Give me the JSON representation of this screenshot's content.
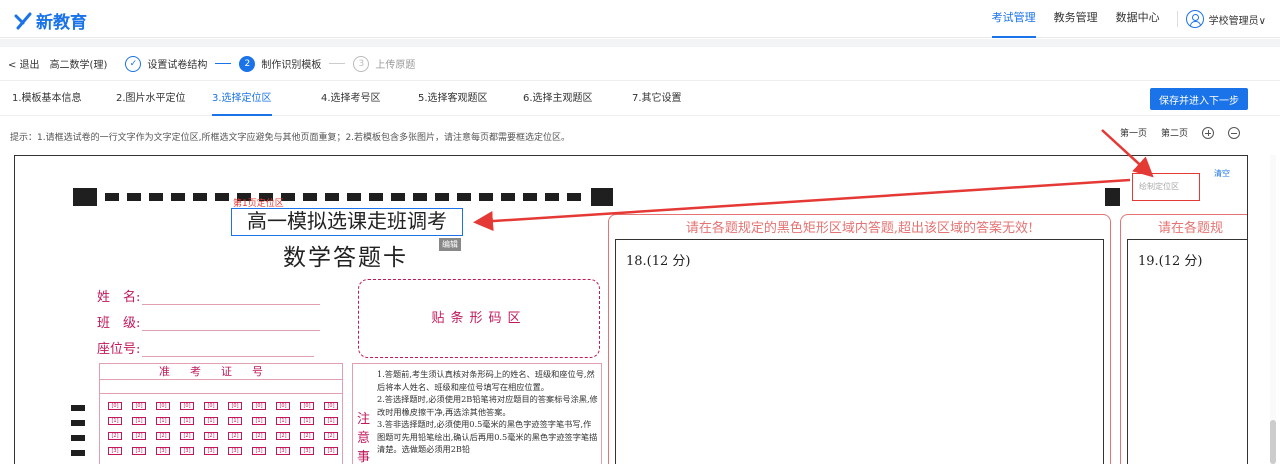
{
  "app": {
    "logo_text": "新教育"
  },
  "topnav": {
    "items": [
      "考试管理",
      "教务管理",
      "数据中心"
    ],
    "active_index": 0,
    "user_label": "学校管理员∨"
  },
  "stepbar": {
    "back_label": "< 退出",
    "subject": "高二数学(理)",
    "steps": [
      {
        "label": "设置试卷结构",
        "state": "done",
        "mark": "✓"
      },
      {
        "label": "制作识别模板",
        "state": "active",
        "mark": "2"
      },
      {
        "label": "上传原题",
        "state": "pending",
        "mark": "3"
      }
    ]
  },
  "tabs": {
    "items": [
      "1.模板基本信息",
      "2.图片水平定位",
      "3.选择定位区",
      "4.选择考号区",
      "5.选择客观题区",
      "6.选择主观题区",
      "7.其它设置"
    ],
    "active_index": 2,
    "save_label": "保存并进入下一步"
  },
  "hint": "提示：1.请框选试卷的一行文字作为文字定位区,所框选文字应避免与其他页面重复；2.若模板包含多张图片，请注意每页都需要框选定位区。",
  "pager": {
    "page1": "第一页",
    "page2": "第二页"
  },
  "sheet": {
    "loc_label": "第1页定位区",
    "title": "高一模拟选课走班调考",
    "edit": "编辑",
    "card_title": "数学答题卡",
    "fields": [
      "姓　名:",
      "班　级:",
      "座位号:"
    ],
    "barcode": "贴条形码区",
    "ticket_head": "准考证号",
    "notice_title": "注意事",
    "notice_text": "1.答题前,考生须认真核对条形码上的姓名、班级和座位号,然后将本人姓名、班级和座位号填写在相应位置。\n2.答选择题时,必须使用2B铅笔将对应题目的答案标号涂黑,修改时用橡皮擦干净,再选涂其他答案。\n3.答非选择题时,必须使用0.5毫米的黑色字迹签字笔书写,作图题可先用铅笔绘出,确认后再用0.5毫米的黑色字迹签字笔描清楚。选做题必须用2B铅",
    "answer_head": "请在各题规定的黑色矩形区域内答题,超出该区域的答案无效!",
    "answer_head_short": "请在各题规",
    "q18": "18.(12 分)",
    "q19": "19.(12 分)"
  },
  "loc_panel": {
    "placeholder": "绘制定位区",
    "clear": "清空"
  },
  "colors": {
    "accent": "#1a73e8",
    "sheet_red": "#c2185b",
    "annotation_red": "#e53935"
  }
}
